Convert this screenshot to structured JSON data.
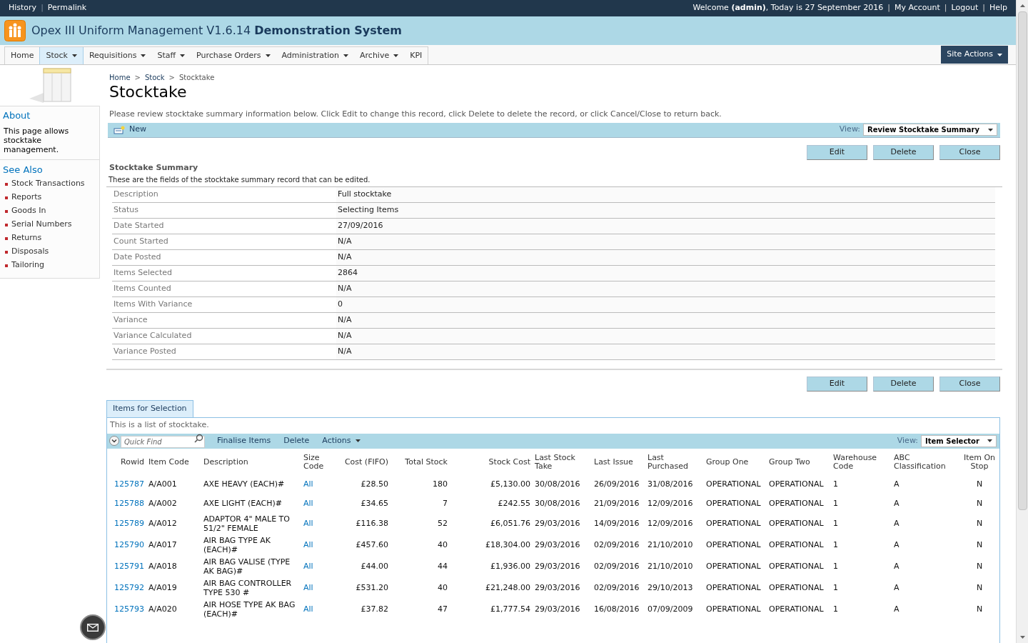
{
  "top_bar": {
    "links_left": [
      "History",
      "Permalink"
    ],
    "separator": "|",
    "welcome": "Welcome **(admin)**, Today is 27 September 2016",
    "links_right": [
      "My Account",
      "Logout",
      "Help"
    ]
  },
  "header": {
    "title": "Opex III Uniform Management V1.6.14 **Demonstration System**"
  },
  "nav": {
    "items": [
      {
        "label": "Home",
        "has_menu": false,
        "selected": false
      },
      {
        "label": "Stock",
        "has_menu": true,
        "selected": true
      },
      {
        "label": "Requisitions",
        "has_menu": true,
        "selected": false
      },
      {
        "label": "Staff",
        "has_menu": true,
        "selected": false
      },
      {
        "label": "Purchase Orders",
        "has_menu": true,
        "selected": false
      },
      {
        "label": "Administration",
        "has_menu": true,
        "selected": false
      },
      {
        "label": "Archive",
        "has_menu": true,
        "selected": false
      },
      {
        "label": "KPI",
        "has_menu": false,
        "selected": false
      }
    ],
    "site_actions": "Site Actions"
  },
  "sidebar": {
    "about_title": "About",
    "about_text": "This page allows stocktake management.",
    "see_also_title": "See Also",
    "links": [
      "Stock Transactions",
      "Reports",
      "Goods In",
      "Serial Numbers",
      "Returns",
      "Disposals",
      "Tailoring"
    ]
  },
  "breadcrumb": {
    "items": [
      "Home",
      "Stock",
      "Stocktake"
    ],
    "separator": ">"
  },
  "page_title": "Stocktake",
  "intro": "Please review stocktake summary information below. Click Edit to change this record, click Delete to delete the record, or click Cancel/Close to return back.",
  "toolbar": {
    "new_label": "New",
    "view_label": "View:",
    "view_value": "Review Stocktake Summary"
  },
  "buttons_top": [
    "Edit",
    "Delete",
    "Close"
  ],
  "summary": {
    "title": "Stocktake Summary",
    "subtitle": "These are the fields of the stocktake summary record that can be edited.",
    "fields": [
      {
        "label": "Description",
        "value": "Full stocktake"
      },
      {
        "label": "Status",
        "value": "Selecting Items"
      },
      {
        "label": "Date Started",
        "value": "27/09/2016"
      },
      {
        "label": "Count Started",
        "value": "N/A"
      },
      {
        "label": "Date Posted",
        "value": "N/A"
      },
      {
        "label": "Items Selected",
        "value": "2864"
      },
      {
        "label": "Items Counted",
        "value": "N/A"
      },
      {
        "label": "Items With Variance",
        "value": "0"
      },
      {
        "label": "Variance",
        "value": "N/A"
      },
      {
        "label": "Variance Calculated",
        "value": "N/A"
      },
      {
        "label": "Variance Posted",
        "value": "N/A"
      }
    ]
  },
  "buttons_bottom": [
    "Edit",
    "Delete",
    "Close"
  ],
  "items": {
    "tab": "Items for Selection",
    "description": "This is a list of stocktake.",
    "quick_find": {
      "placeholder": "Quick Find"
    },
    "actions": [
      {
        "label": "Finalise Items",
        "has_menu": false
      },
      {
        "label": "Delete",
        "has_menu": false
      },
      {
        "label": "Actions",
        "has_menu": true
      }
    ],
    "view_label": "View:",
    "view_value": "Item Selector",
    "columns": [
      "Rowid",
      "Item Code",
      "Description",
      "Size Code",
      "Cost (FIFO)",
      "Total Stock",
      "Stock Cost",
      "Last Stock Take",
      "Last Issue",
      "Last Purchased",
      "Group One",
      "Group Two",
      "Warehouse Code",
      "ABC Classification",
      "Item On Stop"
    ],
    "rows": [
      [
        "125787",
        "A/A001",
        "AXE HEAVY (EACH)#",
        "All",
        "£28.50",
        "180",
        "£5,130.00",
        "30/08/2016",
        "26/09/2016",
        "31/08/2016",
        "OPERATIONAL",
        "OPERATIONAL",
        "1",
        "A",
        "N"
      ],
      [
        "125788",
        "A/A002",
        "AXE LIGHT (EACH)#",
        "All",
        "£34.65",
        "7",
        "£242.55",
        "30/08/2016",
        "21/09/2016",
        "12/09/2016",
        "OPERATIONAL",
        "OPERATIONAL",
        "1",
        "A",
        "N"
      ],
      [
        "125789",
        "A/A012",
        "ADAPTOR 4\" MALE TO 51/2\" FEMALE",
        "All",
        "£116.38",
        "52",
        "£6,051.76",
        "29/03/2016",
        "14/09/2016",
        "12/09/2016",
        "OPERATIONAL",
        "OPERATIONAL",
        "1",
        "A",
        "N"
      ],
      [
        "125790",
        "A/A017",
        "AIR BAG TYPE AK (EACH)#",
        "All",
        "£457.60",
        "40",
        "£18,304.00",
        "29/03/2016",
        "02/09/2016",
        "21/10/2010",
        "OPERATIONAL",
        "OPERATIONAL",
        "1",
        "A",
        "N"
      ],
      [
        "125791",
        "A/A018",
        "AIR BAG VALISE (TYPE AK BAG)#",
        "All",
        "£44.00",
        "44",
        "£1,936.00",
        "29/03/2016",
        "02/09/2016",
        "21/10/2010",
        "OPERATIONAL",
        "OPERATIONAL",
        "1",
        "A",
        "N"
      ],
      [
        "125792",
        "A/A019",
        "AIR BAG CONTROLLER TYPE 530 #",
        "All",
        "£531.20",
        "40",
        "£21,248.00",
        "29/03/2016",
        "02/09/2016",
        "29/10/2013",
        "OPERATIONAL",
        "OPERATIONAL",
        "1",
        "A",
        "N"
      ],
      [
        "125793",
        "A/A020",
        "AIR HOSE TYPE AK BAG (EACH)#",
        "All",
        "£37.82",
        "47",
        "£1,777.54",
        "29/03/2016",
        "16/08/2016",
        "07/09/2009",
        "OPERATIONAL",
        "OPERATIONAL",
        "1",
        "A",
        "N"
      ]
    ]
  }
}
